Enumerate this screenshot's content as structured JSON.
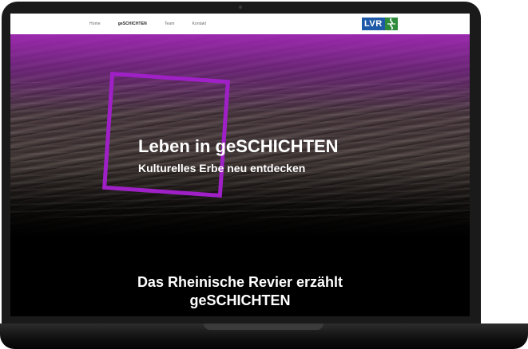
{
  "nav": {
    "items": [
      {
        "label": "Home"
      },
      {
        "label": "geSCHICHTEN",
        "active": true
      },
      {
        "label": "Team"
      },
      {
        "label": "Kontakt"
      }
    ]
  },
  "logo": {
    "text": "LVR",
    "icon": "lvr-river-icon"
  },
  "hero": {
    "title": "Leben in geSCHICHTEN",
    "subtitle": "Kulturelles Erbe neu entdecken"
  },
  "section": {
    "title_line1": "Das Rheinische Revier erzählt",
    "title_line2": "geSCHICHTEN"
  },
  "colors": {
    "accent": "#a020c8",
    "logo_blue": "#1e5aa8",
    "logo_green": "#2e8b3c"
  }
}
